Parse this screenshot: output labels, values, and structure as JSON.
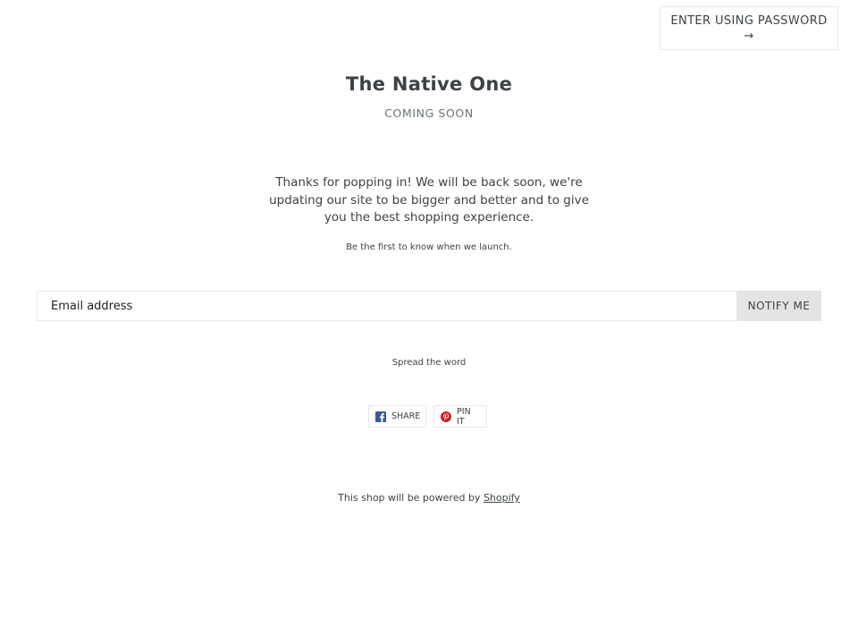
{
  "header": {
    "password_button_label": "Enter using password",
    "password_button_arrow": "→"
  },
  "store": {
    "name": "The Native One",
    "status": "Coming Soon"
  },
  "main": {
    "message": "Thanks for popping in! We will be back soon, we're updating our site to be bigger and better and to give you the best shopping experience.",
    "launch_note": "Be the first to know when we launch."
  },
  "signup": {
    "email_placeholder": "Email address",
    "notify_label": "Notify me"
  },
  "share": {
    "heading": "Spread the word",
    "facebook_label": "Share",
    "pinterest_label": "Pin it"
  },
  "footer": {
    "powered_text": "This shop will be powered by",
    "powered_link": "Shopify"
  },
  "colors": {
    "facebook": "#3b5998",
    "pinterest": "#cb2027",
    "border": "#e8e9eb",
    "notify_bg": "#e4e4e4"
  }
}
